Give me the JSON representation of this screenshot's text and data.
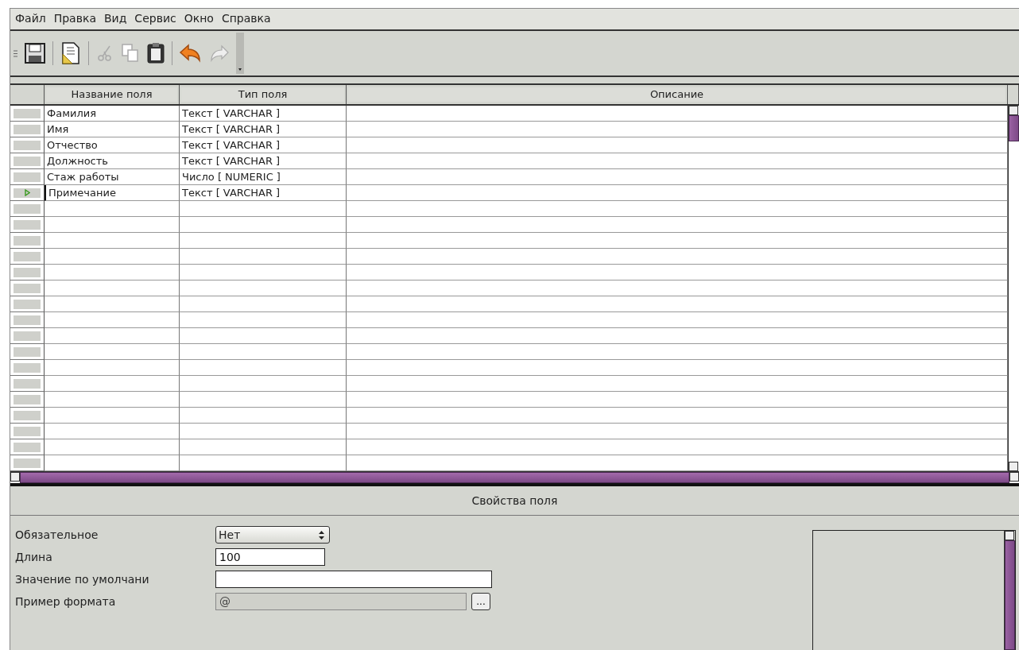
{
  "menu": [
    {
      "label": "Файл"
    },
    {
      "label": "Правка"
    },
    {
      "label": "Вид"
    },
    {
      "label": "Сервис"
    },
    {
      "label": "Окно"
    },
    {
      "label": "Справка"
    }
  ],
  "toolbar": [
    {
      "kind": "grip"
    },
    {
      "kind": "save",
      "disabled": false
    },
    {
      "kind": "separator"
    },
    {
      "kind": "edit",
      "disabled": false
    },
    {
      "kind": "separator"
    },
    {
      "kind": "cut",
      "disabled": true
    },
    {
      "kind": "copy",
      "disabled": true
    },
    {
      "kind": "paste",
      "disabled": false
    },
    {
      "kind": "separator"
    },
    {
      "kind": "undo",
      "disabled": false
    },
    {
      "kind": "redo",
      "disabled": true
    },
    {
      "kind": "overflow"
    }
  ],
  "table": {
    "columns": [
      "Название поля",
      "Тип поля",
      "Описание"
    ],
    "rows": [
      {
        "name": "Фамилия",
        "type": "Текст [ VARCHAR ]",
        "selected": false
      },
      {
        "name": "Имя",
        "type": "Текст [ VARCHAR ]",
        "selected": false
      },
      {
        "name": "Отчество",
        "type": "Текст [ VARCHAR ]",
        "selected": false
      },
      {
        "name": "Должность",
        "type": "Текст [ VARCHAR ]",
        "selected": false
      },
      {
        "name": "Стаж работы",
        "type": "Число [ NUMERIC ]",
        "selected": false
      },
      {
        "name": "Примечание",
        "type": "Текст [ VARCHAR ]",
        "selected": true
      }
    ]
  },
  "properties": {
    "title": "Свойства поля",
    "fields": [
      {
        "label": "Обязательное",
        "kind": "select",
        "value": "Нет"
      },
      {
        "label": "Длина",
        "kind": "text",
        "value": "100"
      },
      {
        "label": "Значение по умолчани",
        "kind": "text"
      },
      {
        "label": "Пример формата",
        "kind": "format",
        "value": "@",
        "disabled": true,
        "button": "..."
      }
    ]
  }
}
